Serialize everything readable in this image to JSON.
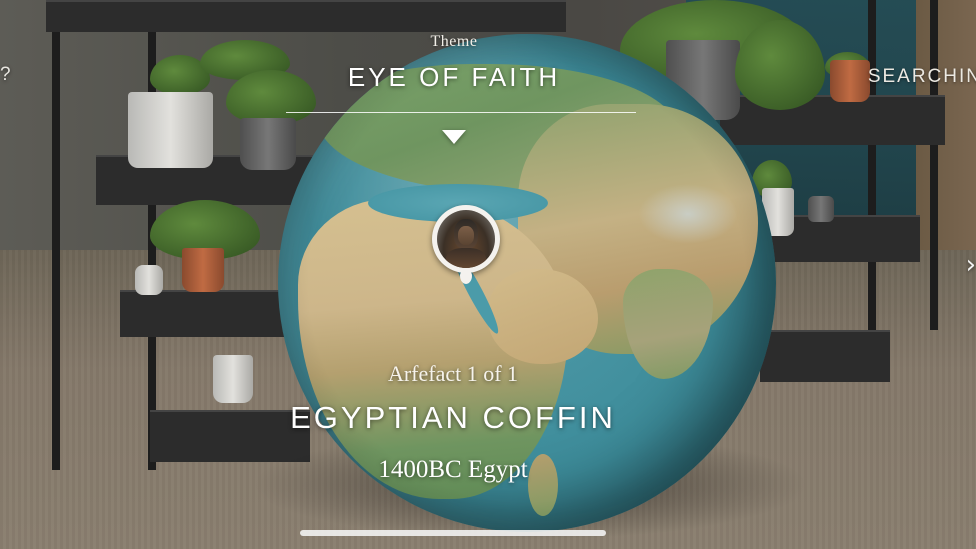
{
  "header": {
    "left_glyph": "?",
    "right_label": "SEARCHIN",
    "theme_caption": "Theme",
    "theme_title": "EYE OF FAITH"
  },
  "artefact": {
    "count_label": "Arfefact 1 of 1",
    "name": "EGYPTIAN COFFIN",
    "detail": "1400BC Egypt",
    "pin_icon": "coffin-portrait-icon"
  },
  "navigation": {
    "next_glyph": "›",
    "dropdown_icon": "triangle-down-icon"
  },
  "colors": {
    "overlay_text": "#ffffff",
    "ocean": "#3d8c9a",
    "land_green": "#6f9560",
    "land_tan": "#cdb68a"
  }
}
